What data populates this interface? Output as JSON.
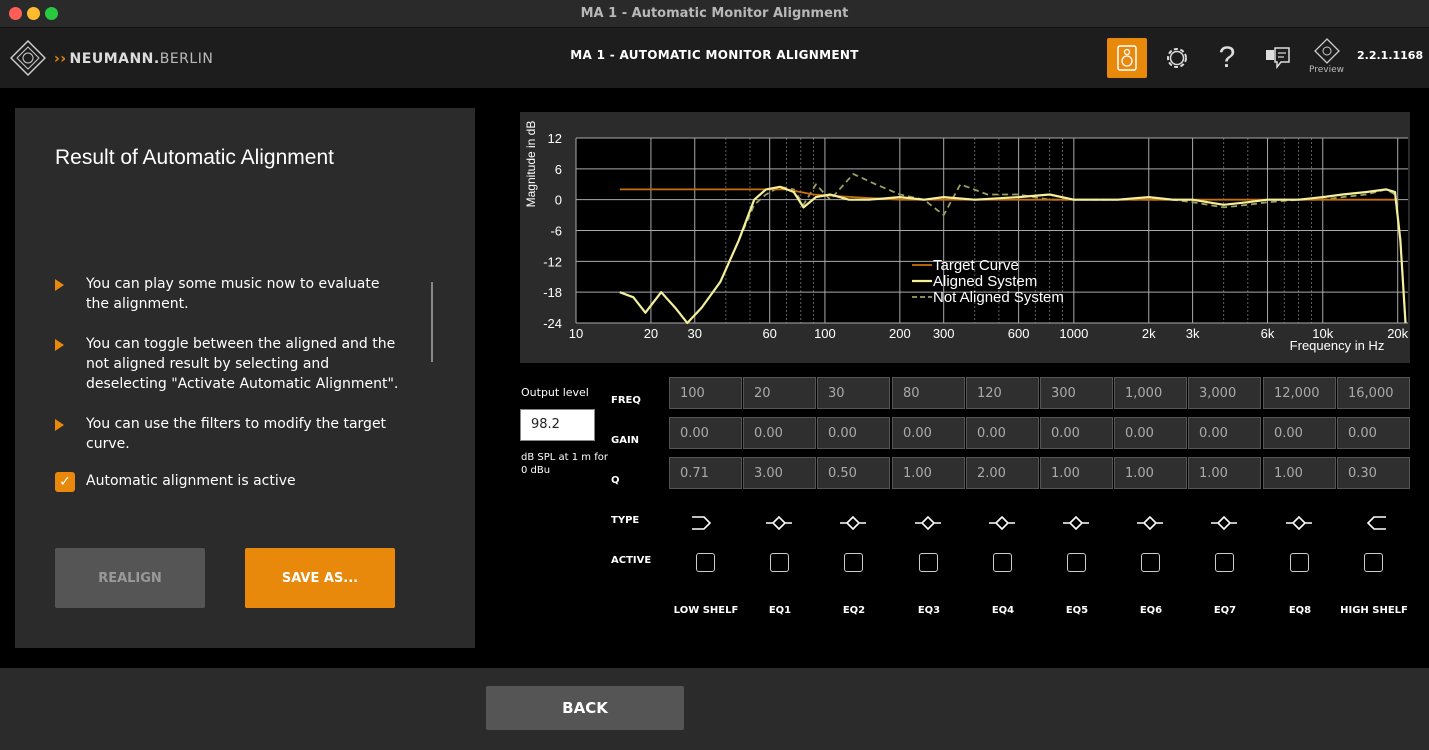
{
  "window": {
    "title": "MA 1 - Automatic Monitor Alignment"
  },
  "header": {
    "brand_bold": "NEUMANN.",
    "brand_light": "BERLIN",
    "title": "MA 1 - AUTOMATIC MONITOR ALIGNMENT",
    "preview_label": "Preview",
    "version": "2.2.1.1168",
    "accent_color": "#e8890b"
  },
  "left": {
    "title": "Result of Automatic Alignment",
    "bullets": [
      "You can play some music now to evaluate the alignment.",
      "You can toggle between the aligned and the not aligned result by selecting and deselecting \"Activate Automatic Alignment\".",
      "You can use the filters to modify the target curve."
    ],
    "checkbox_label": "Automatic alignment is active",
    "checkbox_checked": true,
    "realign_label": "REALIGN",
    "save_label": "SAVE AS..."
  },
  "chart_data": {
    "type": "line",
    "xscale": "log",
    "xlabel": "Frequency in Hz",
    "ylabel": "Magnitude in dB",
    "xlim": [
      10,
      22000
    ],
    "ylim": [
      -24,
      12
    ],
    "x_ticks": [
      10,
      20,
      30,
      60,
      100,
      200,
      300,
      600,
      1000,
      2000,
      3000,
      6000,
      10000,
      20000
    ],
    "x_tick_labels": [
      "10",
      "20",
      "30",
      "60",
      "100",
      "200",
      "300",
      "600",
      "1000",
      "2k",
      "3k",
      "6k",
      "10k",
      "20k"
    ],
    "y_ticks": [
      12,
      6,
      0,
      -6,
      -12,
      -18,
      -24
    ],
    "grid": true,
    "legend_placement": "center",
    "series": [
      {
        "name": "Target Curve",
        "color": "#c8700a",
        "style": "solid",
        "points": [
          [
            15,
            2
          ],
          [
            55,
            2
          ],
          [
            70,
            2
          ],
          [
            90,
            1
          ],
          [
            130,
            0.5
          ],
          [
            200,
            0
          ],
          [
            1000,
            0
          ],
          [
            10000,
            0
          ],
          [
            20000,
            0
          ]
        ]
      },
      {
        "name": "Aligned System",
        "color": "#f4ef9a",
        "style": "solid",
        "points": [
          [
            15,
            -18
          ],
          [
            17,
            -19
          ],
          [
            19,
            -22
          ],
          [
            22,
            -18
          ],
          [
            25,
            -21
          ],
          [
            28,
            -24
          ],
          [
            32,
            -21
          ],
          [
            38,
            -16
          ],
          [
            45,
            -8
          ],
          [
            52,
            0
          ],
          [
            58,
            2
          ],
          [
            66,
            2.5
          ],
          [
            75,
            1.5
          ],
          [
            82,
            -1.5
          ],
          [
            92,
            0.5
          ],
          [
            105,
            1
          ],
          [
            125,
            0
          ],
          [
            150,
            0
          ],
          [
            200,
            0.5
          ],
          [
            250,
            0
          ],
          [
            300,
            0.5
          ],
          [
            400,
            0
          ],
          [
            600,
            0.5
          ],
          [
            800,
            1
          ],
          [
            1000,
            0
          ],
          [
            1500,
            0
          ],
          [
            2000,
            0.5
          ],
          [
            2500,
            0
          ],
          [
            3000,
            0
          ],
          [
            4000,
            -1
          ],
          [
            5000,
            -0.5
          ],
          [
            6000,
            0
          ],
          [
            8000,
            0
          ],
          [
            10000,
            0.5
          ],
          [
            12000,
            1
          ],
          [
            15000,
            1.5
          ],
          [
            18000,
            2
          ],
          [
            19500,
            1.5
          ],
          [
            20500,
            -8
          ],
          [
            21500,
            -24
          ]
        ]
      },
      {
        "name": "Not Aligned System",
        "color": "#9aa060",
        "style": "dashed",
        "points": [
          [
            15,
            -18
          ],
          [
            17,
            -19
          ],
          [
            19,
            -22
          ],
          [
            22,
            -18
          ],
          [
            25,
            -21
          ],
          [
            28,
            -24
          ],
          [
            32,
            -21
          ],
          [
            38,
            -16
          ],
          [
            45,
            -8
          ],
          [
            52,
            -1
          ],
          [
            58,
            1
          ],
          [
            66,
            2.5
          ],
          [
            75,
            2
          ],
          [
            82,
            -1
          ],
          [
            92,
            3
          ],
          [
            105,
            0
          ],
          [
            130,
            5
          ],
          [
            160,
            3
          ],
          [
            200,
            1
          ],
          [
            250,
            0
          ],
          [
            300,
            -3
          ],
          [
            350,
            3
          ],
          [
            450,
            1
          ],
          [
            600,
            1
          ],
          [
            800,
            0
          ],
          [
            1000,
            0
          ],
          [
            1500,
            0
          ],
          [
            2000,
            0
          ],
          [
            2500,
            0
          ],
          [
            3000,
            -0.5
          ],
          [
            4000,
            -1.5
          ],
          [
            5000,
            -1
          ],
          [
            6000,
            -0.5
          ],
          [
            8000,
            0
          ],
          [
            10000,
            0
          ],
          [
            12000,
            0.5
          ],
          [
            15000,
            1
          ],
          [
            18000,
            2
          ],
          [
            19500,
            1
          ],
          [
            20500,
            -8
          ],
          [
            21500,
            -24
          ]
        ]
      }
    ]
  },
  "eq": {
    "output_level_label": "Output level",
    "output_level_value": "98.2",
    "output_level_note": "dB SPL at 1 m for 0 dBu",
    "row_labels": {
      "freq": "FREQ",
      "gain": "GAIN",
      "q": "Q",
      "type": "TYPE",
      "active": "ACTIVE"
    },
    "bands": [
      {
        "name": "LOW SHELF",
        "freq": "100",
        "gain": "0.00",
        "q": "0.71",
        "type": "low-shelf",
        "active": false
      },
      {
        "name": "EQ1",
        "freq": "20",
        "gain": "0.00",
        "q": "3.00",
        "type": "peak",
        "active": false
      },
      {
        "name": "EQ2",
        "freq": "30",
        "gain": "0.00",
        "q": "0.50",
        "type": "peak",
        "active": false
      },
      {
        "name": "EQ3",
        "freq": "80",
        "gain": "0.00",
        "q": "1.00",
        "type": "peak",
        "active": false
      },
      {
        "name": "EQ4",
        "freq": "120",
        "gain": "0.00",
        "q": "2.00",
        "type": "peak",
        "active": false
      },
      {
        "name": "EQ5",
        "freq": "300",
        "gain": "0.00",
        "q": "1.00",
        "type": "peak",
        "active": false
      },
      {
        "name": "EQ6",
        "freq": "1,000",
        "gain": "0.00",
        "q": "1.00",
        "type": "peak",
        "active": false
      },
      {
        "name": "EQ7",
        "freq": "3,000",
        "gain": "0.00",
        "q": "1.00",
        "type": "peak",
        "active": false
      },
      {
        "name": "EQ8",
        "freq": "12,000",
        "gain": "0.00",
        "q": "1.00",
        "type": "peak",
        "active": false
      },
      {
        "name": "HIGH SHELF",
        "freq": "16,000",
        "gain": "0.00",
        "q": "0.30",
        "type": "high-shelf",
        "active": false
      }
    ]
  },
  "footer": {
    "back_label": "BACK"
  }
}
